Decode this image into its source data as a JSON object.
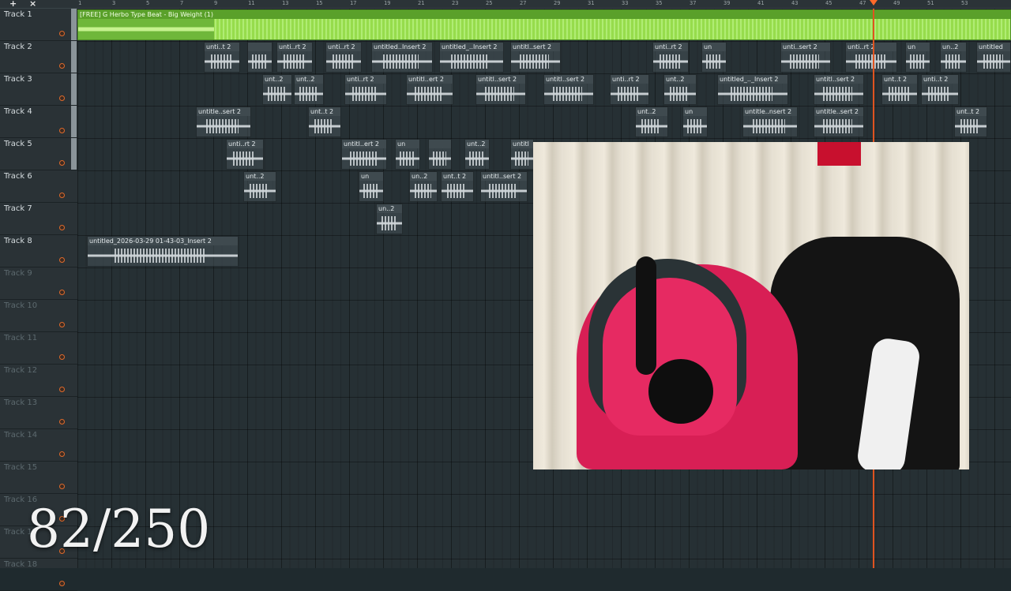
{
  "toolbar": {
    "add_symbol": "+",
    "close_symbol": "×"
  },
  "ruler": {
    "labels": [
      "1",
      "3",
      "5",
      "7",
      "9",
      "11",
      "13",
      "15",
      "17",
      "19",
      "21",
      "23",
      "25",
      "27",
      "29",
      "31",
      "33",
      "35",
      "37",
      "39",
      "41",
      "43",
      "45",
      "47",
      "49",
      "51",
      "53"
    ]
  },
  "tracks": [
    {
      "label": "Track 1"
    },
    {
      "label": "Track 2"
    },
    {
      "label": "Track 3"
    },
    {
      "label": "Track 4"
    },
    {
      "label": "Track 5"
    },
    {
      "label": "Track 6"
    },
    {
      "label": "Track 7"
    },
    {
      "label": "Track 8"
    },
    {
      "label": "Track 9"
    },
    {
      "label": "Track 10"
    },
    {
      "label": "Track 11"
    },
    {
      "label": "Track 12"
    },
    {
      "label": "Track 13"
    },
    {
      "label": "Track 14"
    },
    {
      "label": "Track 15"
    },
    {
      "label": "Track 16"
    },
    {
      "label": "Track 17"
    },
    {
      "label": "Track 18"
    }
  ],
  "clips": {
    "track1": {
      "title": "[FREE] G Herbo Type Beat - Big Weight (1)"
    },
    "track2": [
      "unti..t 2",
      "",
      "unti..rt 2",
      "unti..rt 2",
      "untitled..Insert 2",
      "untitled_..Insert 2",
      "untitl..sert 2",
      "unti..rt 2",
      "un",
      "unti..sert 2",
      "unti..rt 2",
      "un",
      "un..2",
      "untitled"
    ],
    "track3": [
      "unt..2",
      "unt..2",
      "unti..rt 2",
      "untitl..ert 2",
      "untitl..sert 2",
      "untitl..sert 2",
      "unti..rt 2",
      "unt..2",
      "untitled_.._Insert 2",
      "untitl..sert 2",
      "unt..t 2",
      "unti..t 2"
    ],
    "track4": [
      "untitle..sert 2",
      "unt..t 2",
      "unt..2",
      "un",
      "untitle..nsert 2",
      "untitle..sert 2",
      "unt..t 2"
    ],
    "track5": [
      "unti..rt 2",
      "untitl..ert 2",
      "un",
      "",
      "unt..2",
      "untitl"
    ],
    "track6": [
      "unt..2",
      "un",
      "un..2",
      "unt..t 2",
      "untitl..sert 2"
    ],
    "track7": [
      "un..2"
    ],
    "track8": [
      "untitled_2026-03-29 01-43-03_Insert 2"
    ]
  },
  "overlay": {
    "counter_text": "82/250"
  },
  "colors": {
    "beat_clip": "#6fb73a",
    "playhead": "#e0531f",
    "track_record_dot": "#e06a2a"
  }
}
